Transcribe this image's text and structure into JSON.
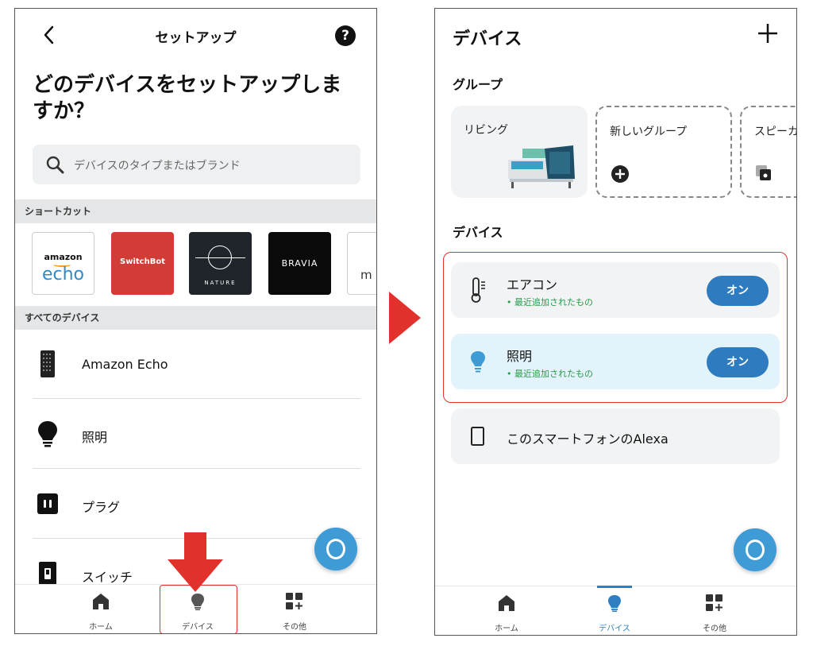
{
  "left_screen": {
    "header": {
      "title": "セットアップ",
      "help_label": "?"
    },
    "question": "どのデバイスをセットアップしますか？",
    "search": {
      "placeholder": "デバイスのタイプまたはブランド"
    },
    "sections": {
      "shortcut": "ショートカット",
      "all_devices": "すべてのデバイス"
    },
    "brands": {
      "echo_top": "amazon",
      "echo_name": "echo",
      "switchbot": "SwitchBot",
      "nature": "NATURE",
      "bravia": "BRAVIA",
      "more": "m"
    },
    "devices": [
      "Amazon Echo",
      "照明",
      "プラグ",
      "スイッチ"
    ],
    "tabs": [
      "ホーム",
      "デバイス",
      "その他"
    ]
  },
  "right_screen": {
    "title": "デバイス",
    "groups_title": "グループ",
    "groups": [
      "リビング",
      "新しいグループ",
      "スピーカー"
    ],
    "devices_title": "デバイス",
    "cards": [
      {
        "name": "エアコン",
        "sub": "• 最近追加されたもの",
        "button": "オン"
      },
      {
        "name": "照明",
        "sub": "• 最近追加されたもの",
        "button": "オン"
      },
      {
        "name": "このスマートフォンのAlexa"
      }
    ],
    "tabs": [
      "ホーム",
      "デバイス",
      "その他"
    ]
  },
  "colors": {
    "accent_blue": "#2e7cbf",
    "alexa_blue": "#3e9bd6",
    "highlight_red": "#e0312c",
    "recent_green": "#2a9a4a"
  }
}
